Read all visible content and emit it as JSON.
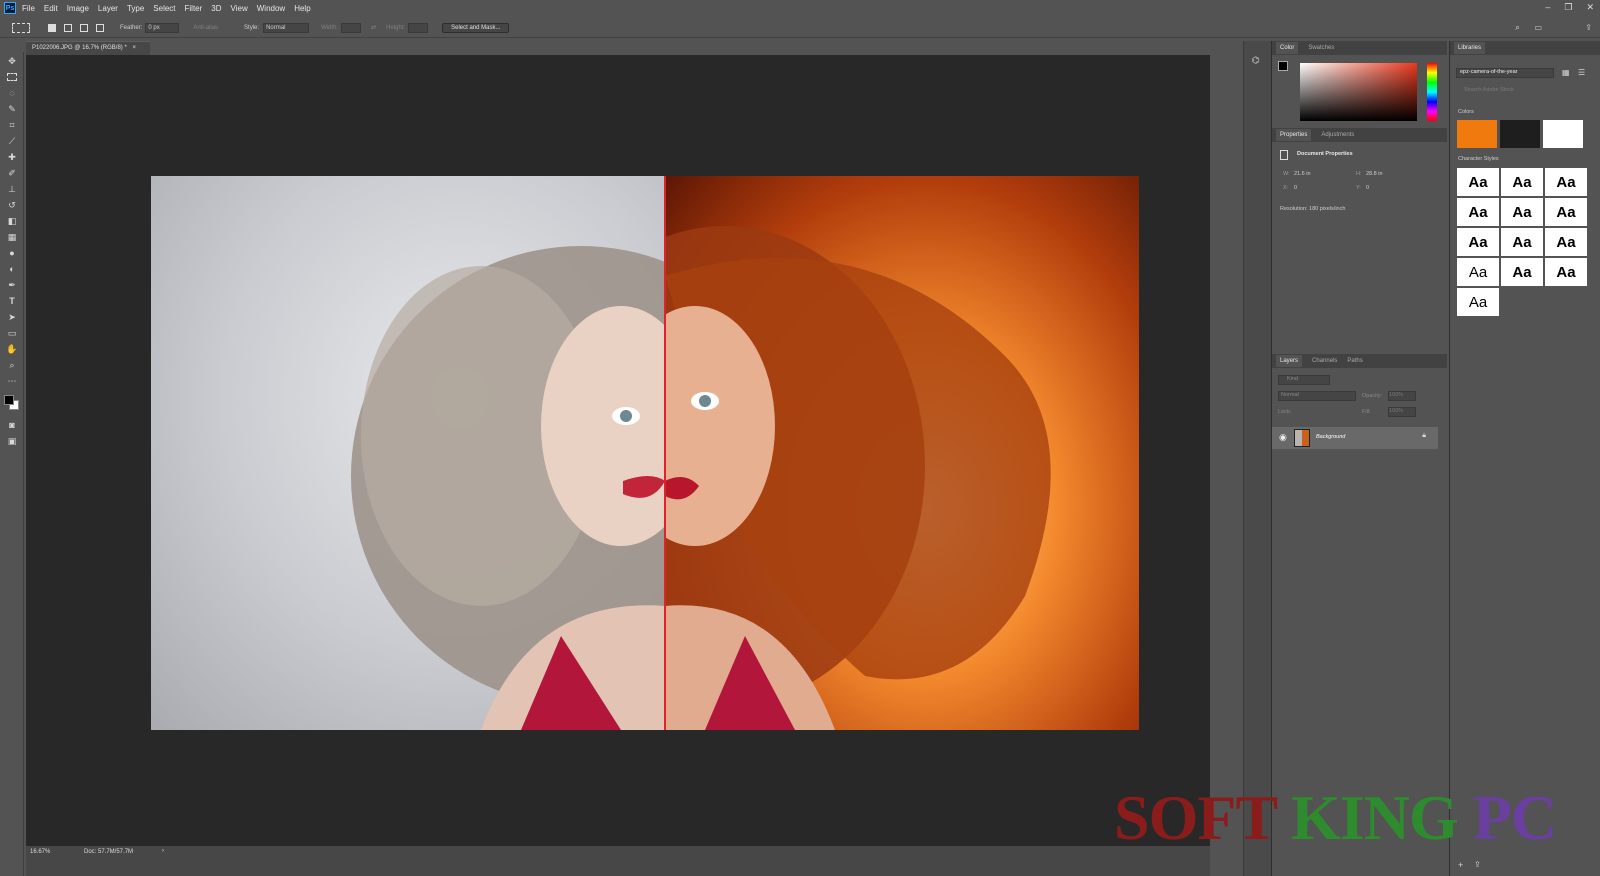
{
  "app": {
    "logo": "Ps"
  },
  "menubar": {
    "items": [
      "File",
      "Edit",
      "Image",
      "Layer",
      "Type",
      "Select",
      "Filter",
      "3D",
      "View",
      "Window",
      "Help"
    ]
  },
  "window_controls": {
    "minimize": "–",
    "restore": "❐",
    "close": "✕"
  },
  "options": {
    "feather_label": "Feather:",
    "feather_value": "0 px",
    "antialias_label": "Anti-alias",
    "style_label": "Style:",
    "style_value": "Normal",
    "width_label": "Width:",
    "height_label": "Height:",
    "select_mask_label": "Select and Mask..."
  },
  "document": {
    "tab_title": "P1022006.JPG @ 16.7% (RGB/8) *",
    "close_glyph": "×",
    "zoom": "16.67%",
    "doc_size": "Doc: 57.7M/57.7M",
    "status_arrow": "›"
  },
  "color_panel": {
    "tabs": [
      "Color",
      "Swatches"
    ]
  },
  "properties_panel": {
    "tabs": [
      "Properties",
      "Adjustments"
    ],
    "title": "Document Properties",
    "w_label": "W:",
    "w_value": "21.6 in",
    "h_label": "H:",
    "h_value": "28.8 in",
    "x_label": "X:",
    "x_value": "0",
    "y_label": "Y:",
    "y_value": "0",
    "resolution": "Resolution: 180 pixels/inch"
  },
  "layers_panel": {
    "tabs": [
      "Layers",
      "Channels",
      "Paths"
    ],
    "kind_placeholder": "Kind",
    "blend_mode": "Normal",
    "opacity_label": "Opacity:",
    "opacity_value": "100%",
    "lock_label": "Lock:",
    "fill_label": "Fill:",
    "fill_value": "100%",
    "layer_name": "Background"
  },
  "libraries_panel": {
    "tab": "Libraries",
    "library_name": "epz-camera-of-the-year",
    "search_placeholder": "Search Adobe Stock",
    "colors_header": "Colors",
    "styles_header": "Character Styles",
    "style_sample": "Aa",
    "colors": [
      "#f07a0e",
      "#1e1e1e",
      "#ffffff"
    ]
  },
  "watermark": {
    "word1": "SOFT",
    "word2": "KING",
    "word3": "PC",
    "color1": "#8b1c1c",
    "color2": "#2e8b2e",
    "color3": "#6b3fa0"
  },
  "icons": [
    "move-icon",
    "marquee-icon",
    "lasso-icon",
    "quick-select-icon",
    "crop-icon",
    "eyedropper-icon",
    "healing-icon",
    "brush-icon",
    "stamp-icon",
    "history-brush-icon",
    "eraser-icon",
    "gradient-icon",
    "blur-icon",
    "dodge-icon",
    "pen-icon",
    "type-icon",
    "path-select-icon",
    "rectangle-icon",
    "hand-icon",
    "zoom-icon",
    "more-icon"
  ]
}
